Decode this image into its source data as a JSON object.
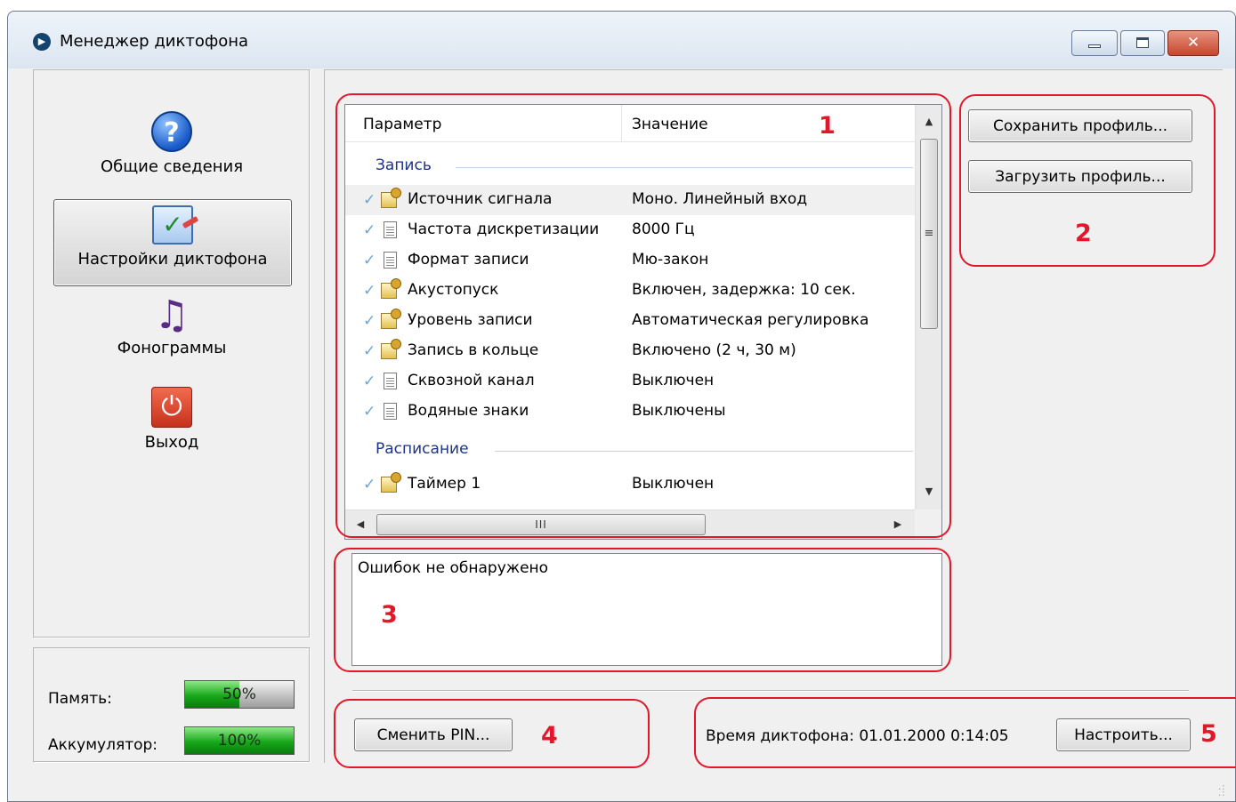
{
  "window": {
    "title": "Менеджер диктофона",
    "close_glyph": "✕"
  },
  "nav": {
    "items": [
      {
        "label": "Общие сведения",
        "icon": "help-icon"
      },
      {
        "label": "Настройки диктофона",
        "icon": "settings-icon"
      },
      {
        "label": "Фонограммы",
        "icon": "music-icon"
      },
      {
        "label": "Выход",
        "icon": "power-icon"
      }
    ]
  },
  "status": {
    "memory_label": "Память:",
    "memory_value": "50%",
    "memory_fraction": 0.5,
    "battery_label": "Аккумулятор:",
    "battery_value": "100%",
    "battery_fraction": 1.0
  },
  "list": {
    "columns": [
      "Параметр",
      "Значение"
    ],
    "groups": [
      {
        "name": "Запись",
        "rows": [
          {
            "name": "Источник сигнала",
            "value": "Моно. Линейный вход",
            "icon": "config-icon"
          },
          {
            "name": "Частота дискретизации",
            "value": "8000 Гц",
            "icon": "document-icon"
          },
          {
            "name": "Формат записи",
            "value": "Мю-закон",
            "icon": "document-icon"
          },
          {
            "name": "Акустопуск",
            "value": "Включен, задержка: 10 сек.",
            "icon": "config-icon"
          },
          {
            "name": "Уровень записи",
            "value": "Автоматическая регулировка",
            "icon": "config-icon"
          },
          {
            "name": "Запись в кольце",
            "value": "Включено (2 ч, 30 м)",
            "icon": "config-icon"
          },
          {
            "name": "Сквозной канал",
            "value": "Выключен",
            "icon": "document-icon"
          },
          {
            "name": "Водяные знаки",
            "value": "Выключены",
            "icon": "document-icon"
          }
        ]
      },
      {
        "name": "Расписание",
        "rows": [
          {
            "name": "Таймер 1",
            "value": "Выключен",
            "icon": "config-icon"
          }
        ]
      }
    ],
    "selected_row": "Источник сигнала",
    "check_glyph": "✓",
    "hscroll_thumb_glyph": "III",
    "vscroll_thumb_glyph": "≡"
  },
  "profile": {
    "save_label": "Сохранить профиль...",
    "load_label": "Загрузить профиль..."
  },
  "errors": {
    "text": "Ошибок не обнаружено"
  },
  "bottom": {
    "change_pin_label": "Сменить PIN...",
    "time_label": "Время диктофона: 01.01.2000 0:14:05",
    "configure_label": "Настроить..."
  },
  "annotations": [
    "1",
    "2",
    "3",
    "4",
    "5"
  ],
  "colors": {
    "annotation_red": "#e4172a",
    "meter_green": "#18a81a",
    "group_blue": "#1e3287"
  }
}
